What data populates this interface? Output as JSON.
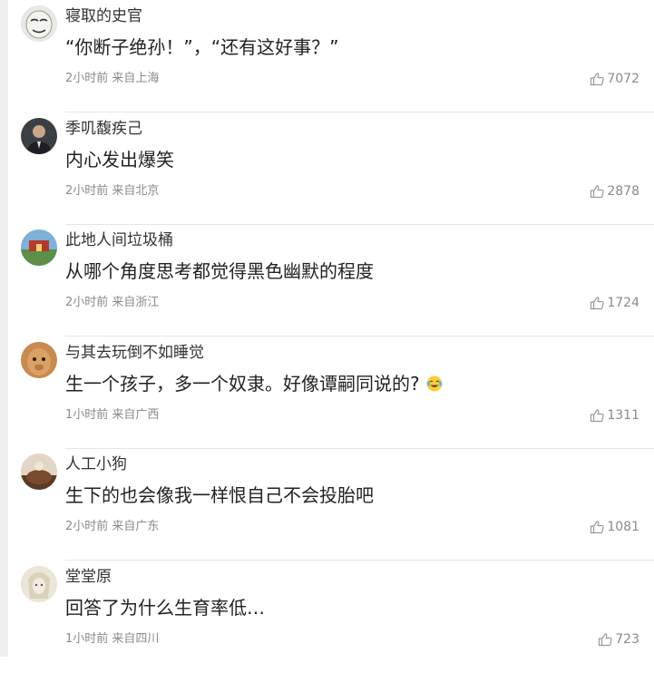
{
  "comments": [
    {
      "username": "寝取的史官",
      "text": "“你断子绝孙！”，“还有这好事？”",
      "time": "2小时前",
      "location": "来自上海",
      "likes": "7072",
      "avatar": "meme-face-avatar",
      "has_emoji": false
    },
    {
      "username": "季叽馥疾己",
      "text": "内心发出爆笑",
      "time": "2小时前",
      "location": "来自北京",
      "likes": "2878",
      "avatar": "man-in-suit-avatar",
      "has_emoji": false
    },
    {
      "username": "此地人间垃圾桶",
      "text": "从哪个角度思考都觉得黑色幽默的程度",
      "time": "2小时前",
      "location": "来自浙江",
      "likes": "1724",
      "avatar": "landscape-avatar",
      "has_emoji": false
    },
    {
      "username": "与其去玩倒不如睡觉",
      "text": "生一个孩子，多一个奴隶。好像谭嗣同说的?",
      "time": "1小时前",
      "location": "来自广西",
      "likes": "1311",
      "avatar": "alpaca-avatar",
      "has_emoji": true,
      "emoji": "crying-laughing-emoji"
    },
    {
      "username": "人工小狗",
      "text": "生下的也会像我一样恨自己不会投胎吧",
      "time": "2小时前",
      "location": "来自广东",
      "likes": "1081",
      "avatar": "sunset-avatar",
      "has_emoji": false
    },
    {
      "username": "堂堂原",
      "text": "回答了为什么生育率低…",
      "time": "1小时前",
      "location": "来自四川",
      "likes": "723",
      "avatar": "anime-character-avatar",
      "has_emoji": false
    }
  ],
  "colors": {
    "text": "#222222",
    "meta": "#8a8a8a",
    "divider": "#e6e6e6"
  },
  "icons": {
    "like": "thumbs-up-icon"
  }
}
